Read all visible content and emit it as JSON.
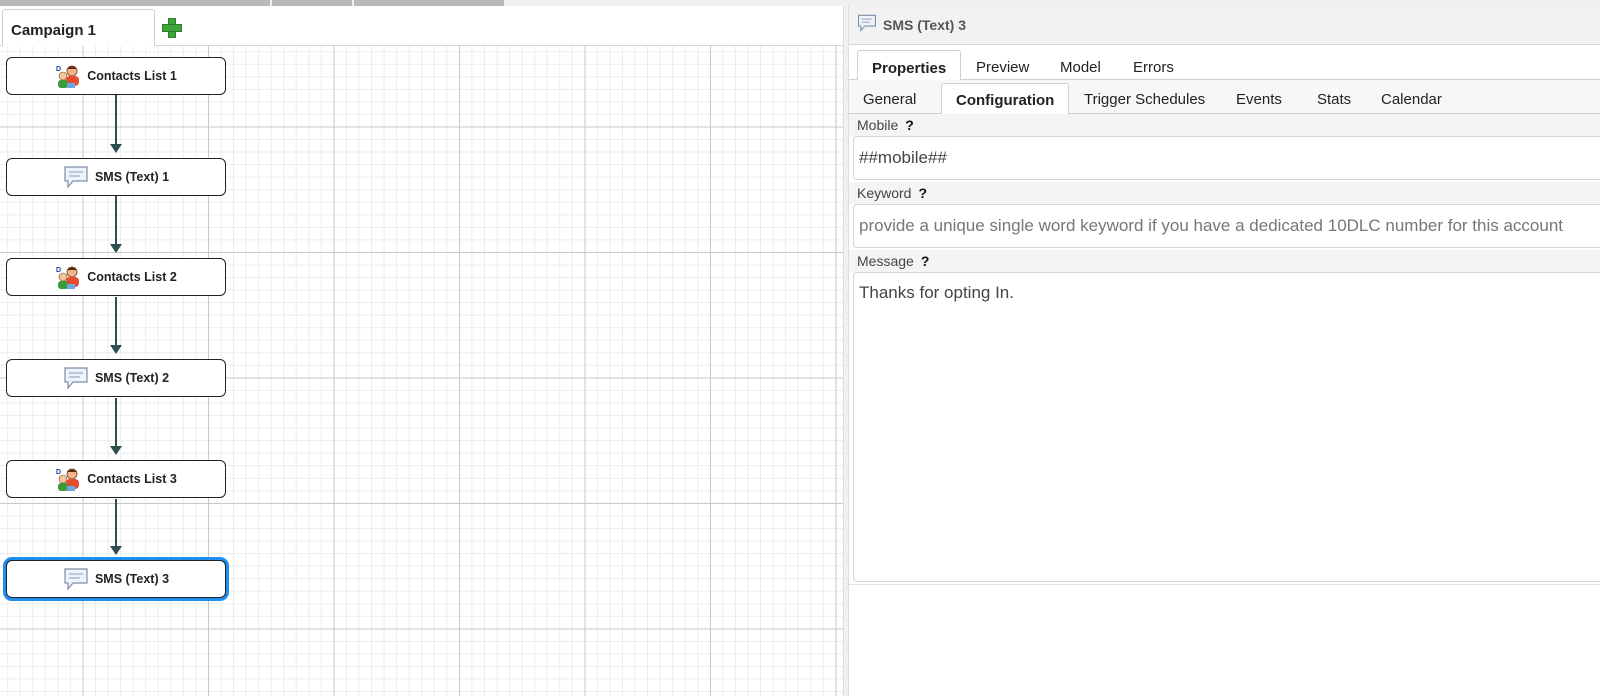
{
  "canvas": {
    "tab_label": "Campaign 1",
    "nodes": [
      {
        "label": "Contacts List 1",
        "icon": "contacts-list-icon"
      },
      {
        "label": "SMS (Text) 1",
        "icon": "sms-bubble-icon"
      },
      {
        "label": "Contacts List 2",
        "icon": "contacts-list-icon"
      },
      {
        "label": "SMS (Text) 2",
        "icon": "sms-bubble-icon"
      },
      {
        "label": "Contacts List 3",
        "icon": "contacts-list-icon"
      },
      {
        "label": "SMS (Text) 3",
        "icon": "sms-bubble-icon",
        "selected": true
      }
    ]
  },
  "panel": {
    "title": "SMS (Text) 3",
    "primary_tabs": [
      "Properties",
      "Preview",
      "Model",
      "Errors"
    ],
    "primary_active": "Properties",
    "secondary_tabs": [
      "General",
      "Configuration",
      "Trigger Schedules",
      "Events",
      "Stats",
      "Calendar"
    ],
    "secondary_active": "Configuration",
    "fields": {
      "mobile": {
        "label": "Mobile",
        "help": "?",
        "value": "##mobile##"
      },
      "keyword": {
        "label": "Keyword",
        "help": "?",
        "placeholder": "provide a unique single word keyword if you have a dedicated 10DLC number for this account"
      },
      "message": {
        "label": "Message",
        "help": "?",
        "value": "Thanks for opting In."
      }
    }
  },
  "colors": {
    "selection": "#1e8ef0",
    "connector": "#2f4f4f",
    "add_button": "#3fa53b"
  }
}
